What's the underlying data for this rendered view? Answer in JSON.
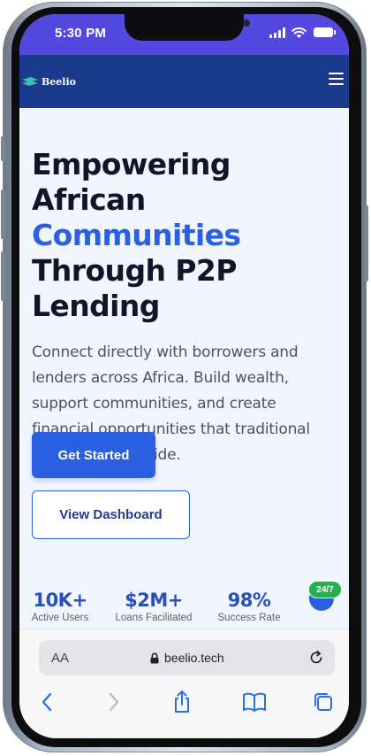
{
  "status_bar": {
    "time": "5:30 PM"
  },
  "header": {
    "brand": "Beelio"
  },
  "hero": {
    "title_line1": "Empowering African",
    "title_accent": "Communities",
    "title_line3": "Through P2P Lending",
    "description": "Connect directly with borrowers and lenders across Africa. Build wealth, support communities, and create financial opportunities that traditional banks can't provide."
  },
  "buttons": {
    "primary": "Get Started",
    "secondary": "View Dashboard"
  },
  "stats": [
    {
      "value": "10K+",
      "label": "Active Users"
    },
    {
      "value": "$2M+",
      "label": "Loans Facilitated"
    },
    {
      "value": "98%",
      "label": "Success Rate"
    }
  ],
  "support_badge": "24/7",
  "browser": {
    "text_size": "AA",
    "url": "beelio.tech"
  },
  "colors": {
    "status_bar": "#5348e0",
    "header": "#1b3a8c",
    "accent": "#2b61e0",
    "badge": "#22b14c"
  },
  "icons": [
    "logo-icon",
    "menu-icon",
    "lock-icon",
    "reload-icon",
    "back-icon",
    "forward-icon",
    "share-icon",
    "bookmarks-icon",
    "tabs-icon"
  ]
}
